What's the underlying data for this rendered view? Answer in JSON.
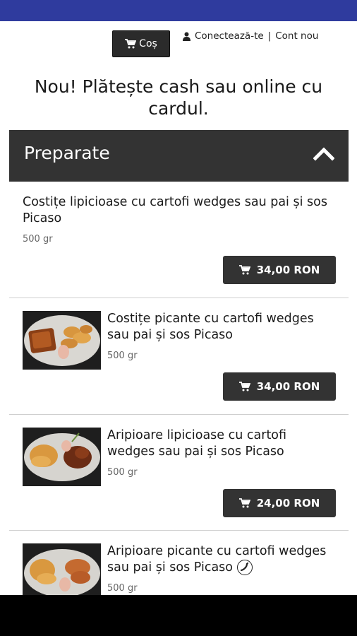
{
  "header": {
    "cart_label": "Coș",
    "login_label": "Conectează-te",
    "separator": "|",
    "register_label": "Cont nou"
  },
  "notice": "Nou! Plătește cash sau online cu cardul.",
  "section": {
    "title": "Preparate"
  },
  "products": [
    {
      "name": "Costițe lipicioase cu cartofi wedges sau pai și sos Picaso",
      "weight": "500 gr",
      "price": "34,00 RON"
    },
    {
      "name": "Costițe picante cu cartofi wedges sau pai și sos Picaso",
      "weight": "500 gr",
      "price": "34,00 RON"
    },
    {
      "name": "Aripioare lipicioase cu cartofi wedges sau pai și sos Picaso",
      "weight": "500 gr",
      "price": "24,00 RON"
    },
    {
      "name": "Aripioare picante cu cartofi wedges sau pai și sos Picaso",
      "weight": "500 gr"
    }
  ],
  "colors": {
    "top_bar": "#2f3b9e",
    "dark_button": "#333333"
  }
}
